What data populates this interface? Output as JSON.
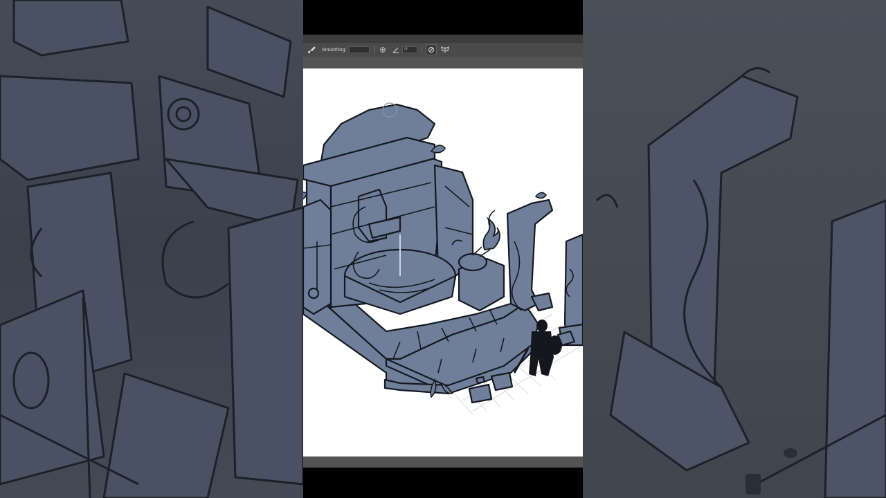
{
  "options_bar": {
    "smoothing_label": "Smoothing:",
    "angle_value": "0°"
  },
  "icons": {
    "brush": "brush-icon",
    "settings": "gear-icon",
    "angle": "angle-icon",
    "pressure": "pressure-icon",
    "symmetry": "symmetry-icon"
  },
  "colors": {
    "artwork_fill": "#6f7f99",
    "artwork_line": "#141820",
    "canvas": "#ffffff"
  }
}
